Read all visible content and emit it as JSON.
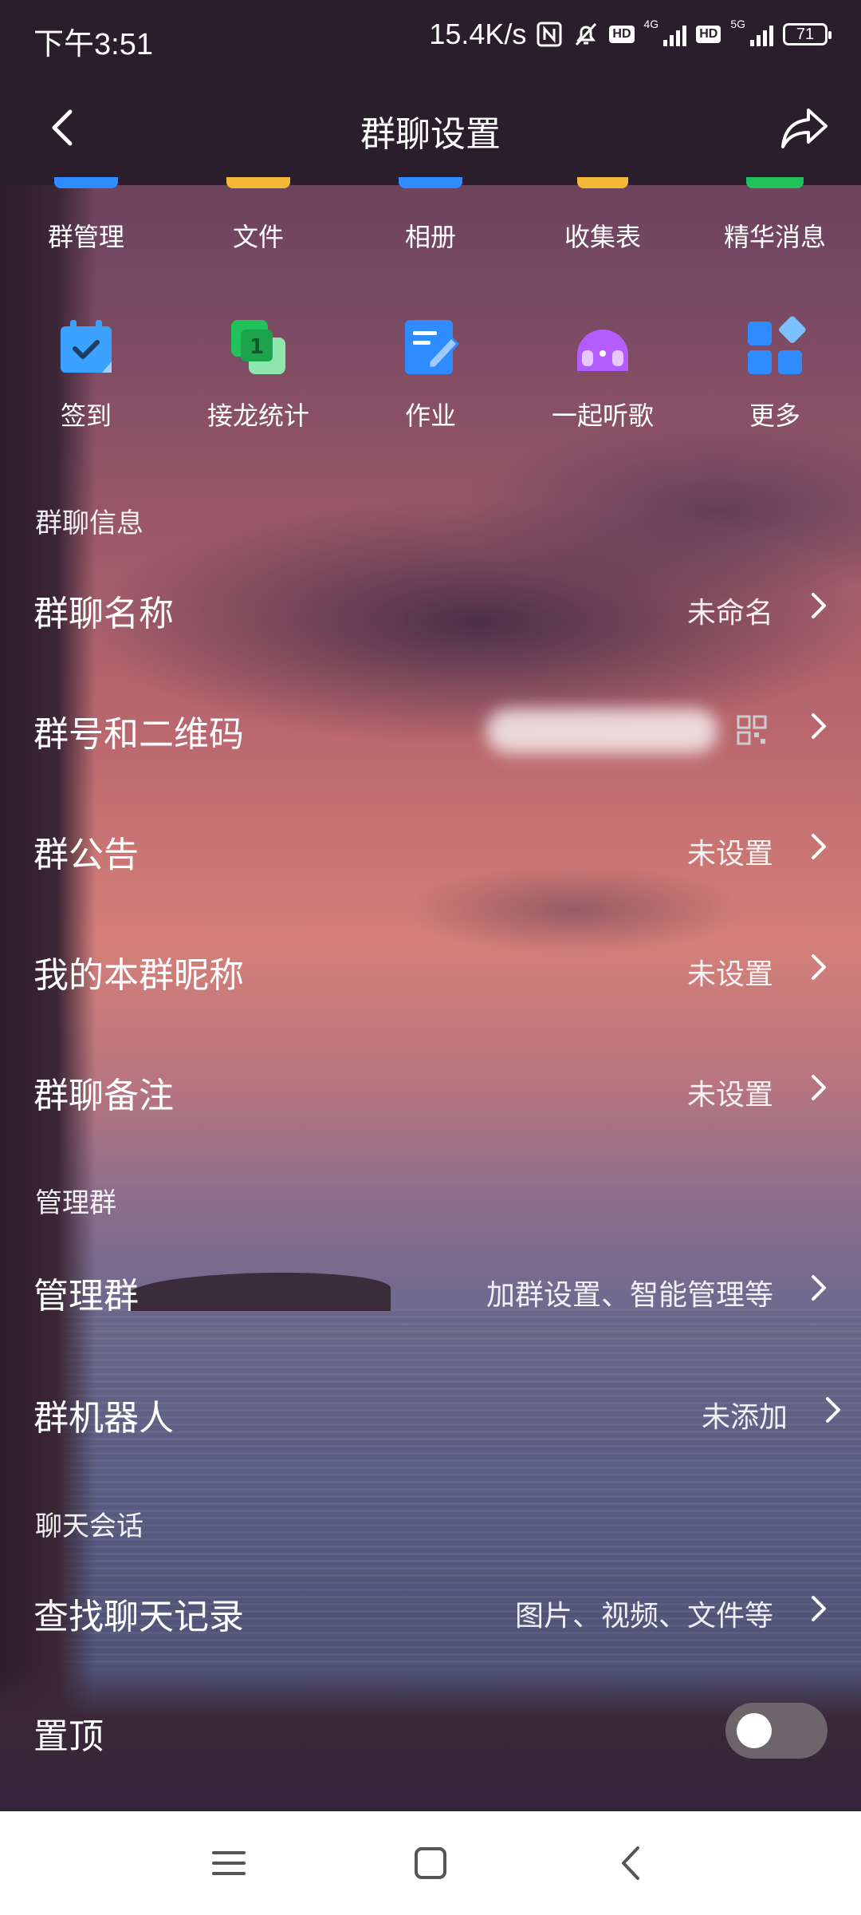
{
  "status": {
    "time": "下午3:51",
    "speed": "15.4K/s",
    "net1": "4G",
    "net2": "5G",
    "hd": "HD",
    "battery": "71"
  },
  "header": {
    "title": "群聊设置"
  },
  "tools_row1": [
    {
      "label": "群管理",
      "icon": "group-manage-icon"
    },
    {
      "label": "文件",
      "icon": "folder-icon"
    },
    {
      "label": "相册",
      "icon": "album-icon"
    },
    {
      "label": "收集表",
      "icon": "form-icon"
    },
    {
      "label": "精华消息",
      "icon": "highlight-message-icon"
    }
  ],
  "tools_row2": [
    {
      "label": "签到",
      "icon": "calendar-check-icon",
      "color": "#3aa1ff"
    },
    {
      "label": "接龙统计",
      "icon": "relay-stats-icon",
      "color": "#22c25a"
    },
    {
      "label": "作业",
      "icon": "homework-icon",
      "color": "#2f8cff"
    },
    {
      "label": "一起听歌",
      "icon": "listen-together-icon",
      "color": "#b35cff"
    },
    {
      "label": "更多",
      "icon": "more-grid-icon",
      "color": "#2f8cff"
    }
  ],
  "sections": {
    "info": "群聊信息",
    "manage": "管理群",
    "chat": "聊天会话"
  },
  "rows": {
    "name": {
      "label": "群聊名称",
      "value": "未命名"
    },
    "qrcode": {
      "label": "群号和二维码"
    },
    "notice": {
      "label": "群公告",
      "value": "未设置"
    },
    "nickname": {
      "label": "我的本群昵称",
      "value": "未设置"
    },
    "remark": {
      "label": "群聊备注",
      "value": "未设置"
    },
    "manage": {
      "label": "管理群",
      "value": "加群设置、智能管理等"
    },
    "robot": {
      "label": "群机器人",
      "value": "未添加"
    },
    "search": {
      "label": "查找聊天记录",
      "value": "图片、视频、文件等"
    },
    "pin": {
      "label": "置顶",
      "on": false
    }
  }
}
